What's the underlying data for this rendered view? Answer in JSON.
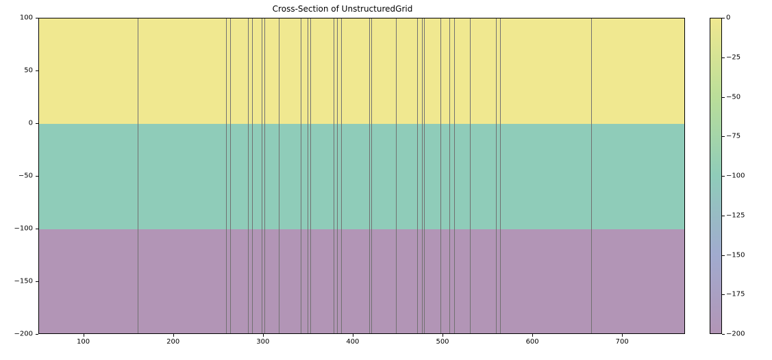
{
  "chart_data": {
    "type": "heatmap",
    "title": "Cross-Section of UnstructuredGrid",
    "xlabel": "",
    "ylabel": "",
    "xlim": [
      50,
      770
    ],
    "ylim": [
      -200,
      100
    ],
    "bands": [
      {
        "y0": 0,
        "y1": 100,
        "value": 0,
        "color": "#f0e890"
      },
      {
        "y0": -100,
        "y1": 0,
        "value": -100,
        "color": "#8fccb9"
      },
      {
        "y0": -200,
        "y1": -100,
        "value": -200,
        "color": "#b295b6"
      }
    ],
    "vlines_x": [
      160,
      258,
      263,
      283,
      287,
      298,
      301,
      317,
      341,
      349,
      352,
      378,
      382,
      386,
      418,
      420,
      447,
      471,
      476,
      479,
      497,
      507,
      512,
      530,
      559,
      563,
      665
    ],
    "xticks": [
      100,
      200,
      300,
      400,
      500,
      600,
      700
    ],
    "yticks": [
      -200,
      -150,
      -100,
      -50,
      0,
      50,
      100
    ],
    "colorbar": {
      "range": [
        -200,
        0
      ],
      "ticks": [
        -200,
        -175,
        -150,
        -125,
        -100,
        -75,
        -50,
        -25,
        0
      ],
      "stops": [
        {
          "at": 0.0,
          "color": "#b295b6"
        },
        {
          "at": 0.25,
          "color": "#a1abcf"
        },
        {
          "at": 0.5,
          "color": "#8fccb9"
        },
        {
          "at": 0.75,
          "color": "#bade99"
        },
        {
          "at": 1.0,
          "color": "#f0e890"
        }
      ]
    }
  }
}
